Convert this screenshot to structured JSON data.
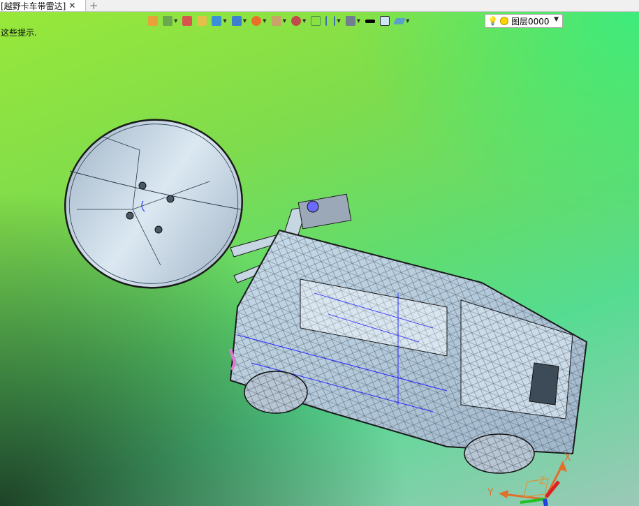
{
  "tab": {
    "label": "[越野卡车带雷达]",
    "close": "✕",
    "add": "+"
  },
  "hint": "这些提示.",
  "toolbar": {
    "items": [
      {
        "name": "import-icon",
        "color": "#e9a23a"
      },
      {
        "name": "layers-icon",
        "color": "#6aa84f"
      },
      {
        "name": "pencil-icon",
        "color": "#d9534f"
      },
      {
        "name": "box-icon",
        "color": "#e4c04a"
      },
      {
        "name": "cube-icon",
        "color": "#3a8fd9"
      },
      {
        "name": "solid-icon",
        "color": "#3e7fd0"
      },
      {
        "name": "render-icon",
        "color": "#e96f2a"
      },
      {
        "name": "frame-icon",
        "color": "#c9a36a"
      },
      {
        "name": "move-icon",
        "color": "#c14a4a"
      },
      {
        "name": "select-icon",
        "color": "#4f8f4f"
      },
      {
        "name": "dimension-icon",
        "color": "#3a6fb0"
      },
      {
        "name": "display-icon",
        "color": "#6f7f8f"
      },
      {
        "name": "line-black-icon",
        "color": "#000000"
      },
      {
        "name": "fill-color-icon",
        "color": "#cfe6f7"
      },
      {
        "name": "view-icon",
        "color": "#5aa0c8"
      }
    ]
  },
  "layer": {
    "name": "图层0000",
    "bulb": "💡"
  },
  "axes": {
    "x": "X",
    "y": "Y",
    "z": "Z"
  }
}
